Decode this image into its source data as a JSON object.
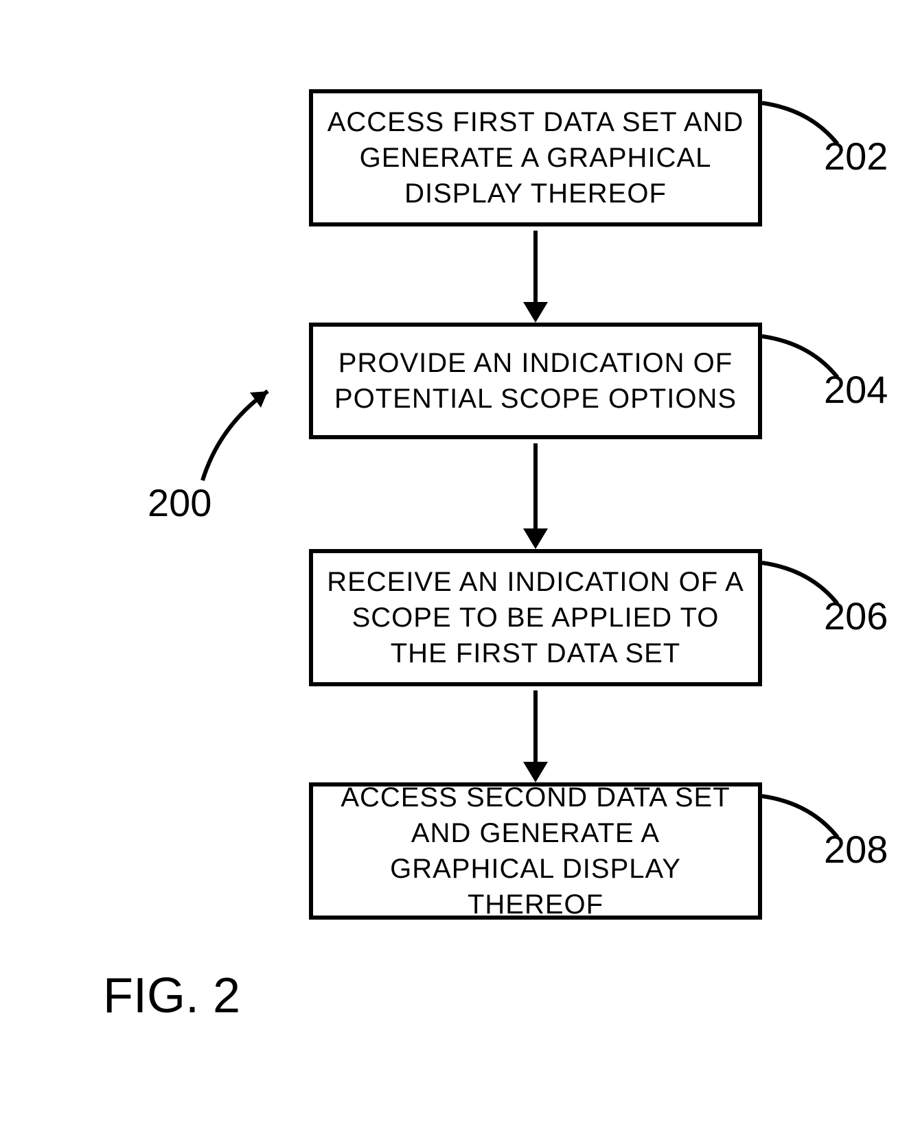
{
  "figure": {
    "ref": "200",
    "caption": "FIG. 2"
  },
  "steps": [
    {
      "id": "202",
      "text": "ACCESS FIRST DATA SET AND GENERATE A GRAPHICAL DISPLAY THEREOF"
    },
    {
      "id": "204",
      "text": "PROVIDE AN INDICATION OF POTENTIAL SCOPE OPTIONS"
    },
    {
      "id": "206",
      "text": "RECEIVE AN INDICATION OF A SCOPE TO BE APPLIED TO THE FIRST DATA SET"
    },
    {
      "id": "208",
      "text": "ACCESS SECOND DATA SET AND GENERATE A GRAPHICAL DISPLAY THEREOF"
    }
  ],
  "chart_data": {
    "type": "flowchart",
    "direction": "top-to-bottom",
    "nodes": [
      {
        "id": "202",
        "label": "ACCESS FIRST DATA SET AND GENERATE A GRAPHICAL DISPLAY THEREOF"
      },
      {
        "id": "204",
        "label": "PROVIDE AN INDICATION OF POTENTIAL SCOPE OPTIONS"
      },
      {
        "id": "206",
        "label": "RECEIVE AN INDICATION OF A SCOPE TO BE APPLIED TO THE FIRST DATA SET"
      },
      {
        "id": "208",
        "label": "ACCESS SECOND DATA SET AND GENERATE A GRAPHICAL DISPLAY THEREOF"
      }
    ],
    "edges": [
      {
        "from": "202",
        "to": "204"
      },
      {
        "from": "204",
        "to": "206"
      },
      {
        "from": "206",
        "to": "208"
      }
    ],
    "reference_numeral": "200",
    "caption": "FIG. 2"
  }
}
